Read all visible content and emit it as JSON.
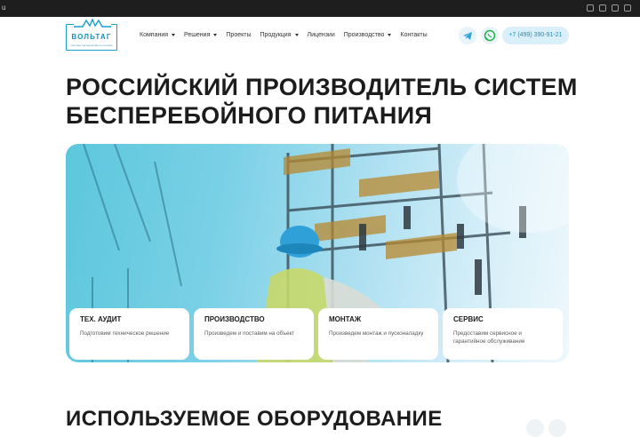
{
  "browser": {
    "url_fragment": "u"
  },
  "logo": {
    "name": "ВОЛЬТАГ",
    "tagline": "системы бесперебойного питания"
  },
  "nav": [
    {
      "label": "Компания",
      "dropdown": true
    },
    {
      "label": "Решения",
      "dropdown": true
    },
    {
      "label": "Проекты",
      "dropdown": false
    },
    {
      "label": "Продукция",
      "dropdown": true
    },
    {
      "label": "Лицензии",
      "dropdown": false
    },
    {
      "label": "Производство",
      "dropdown": true
    },
    {
      "label": "Контакты",
      "dropdown": false
    }
  ],
  "contacts": {
    "phone": "+7 (499) 390-91-21",
    "telegram_icon": "telegram-icon",
    "whatsapp_icon": "whatsapp-icon"
  },
  "hero": {
    "title": "Российский производитель систем бесперебойного питания",
    "cards": [
      {
        "title": "Тех. аудит",
        "text": "Подготовим техническое решение"
      },
      {
        "title": "Производство",
        "text": "Произведем и поставим на объект"
      },
      {
        "title": "Монтаж",
        "text": "Произведем монтаж и пусконаладку"
      },
      {
        "title": "Сервис",
        "text": "Предоставим сервисное и гарантийное обслуживание"
      }
    ]
  },
  "equipment": {
    "title": "Используемое оборудование"
  },
  "colors": {
    "accent": "#1aa0c8",
    "hero_start": "#5cc7dc",
    "phone_bg": "#d9f0fa"
  }
}
